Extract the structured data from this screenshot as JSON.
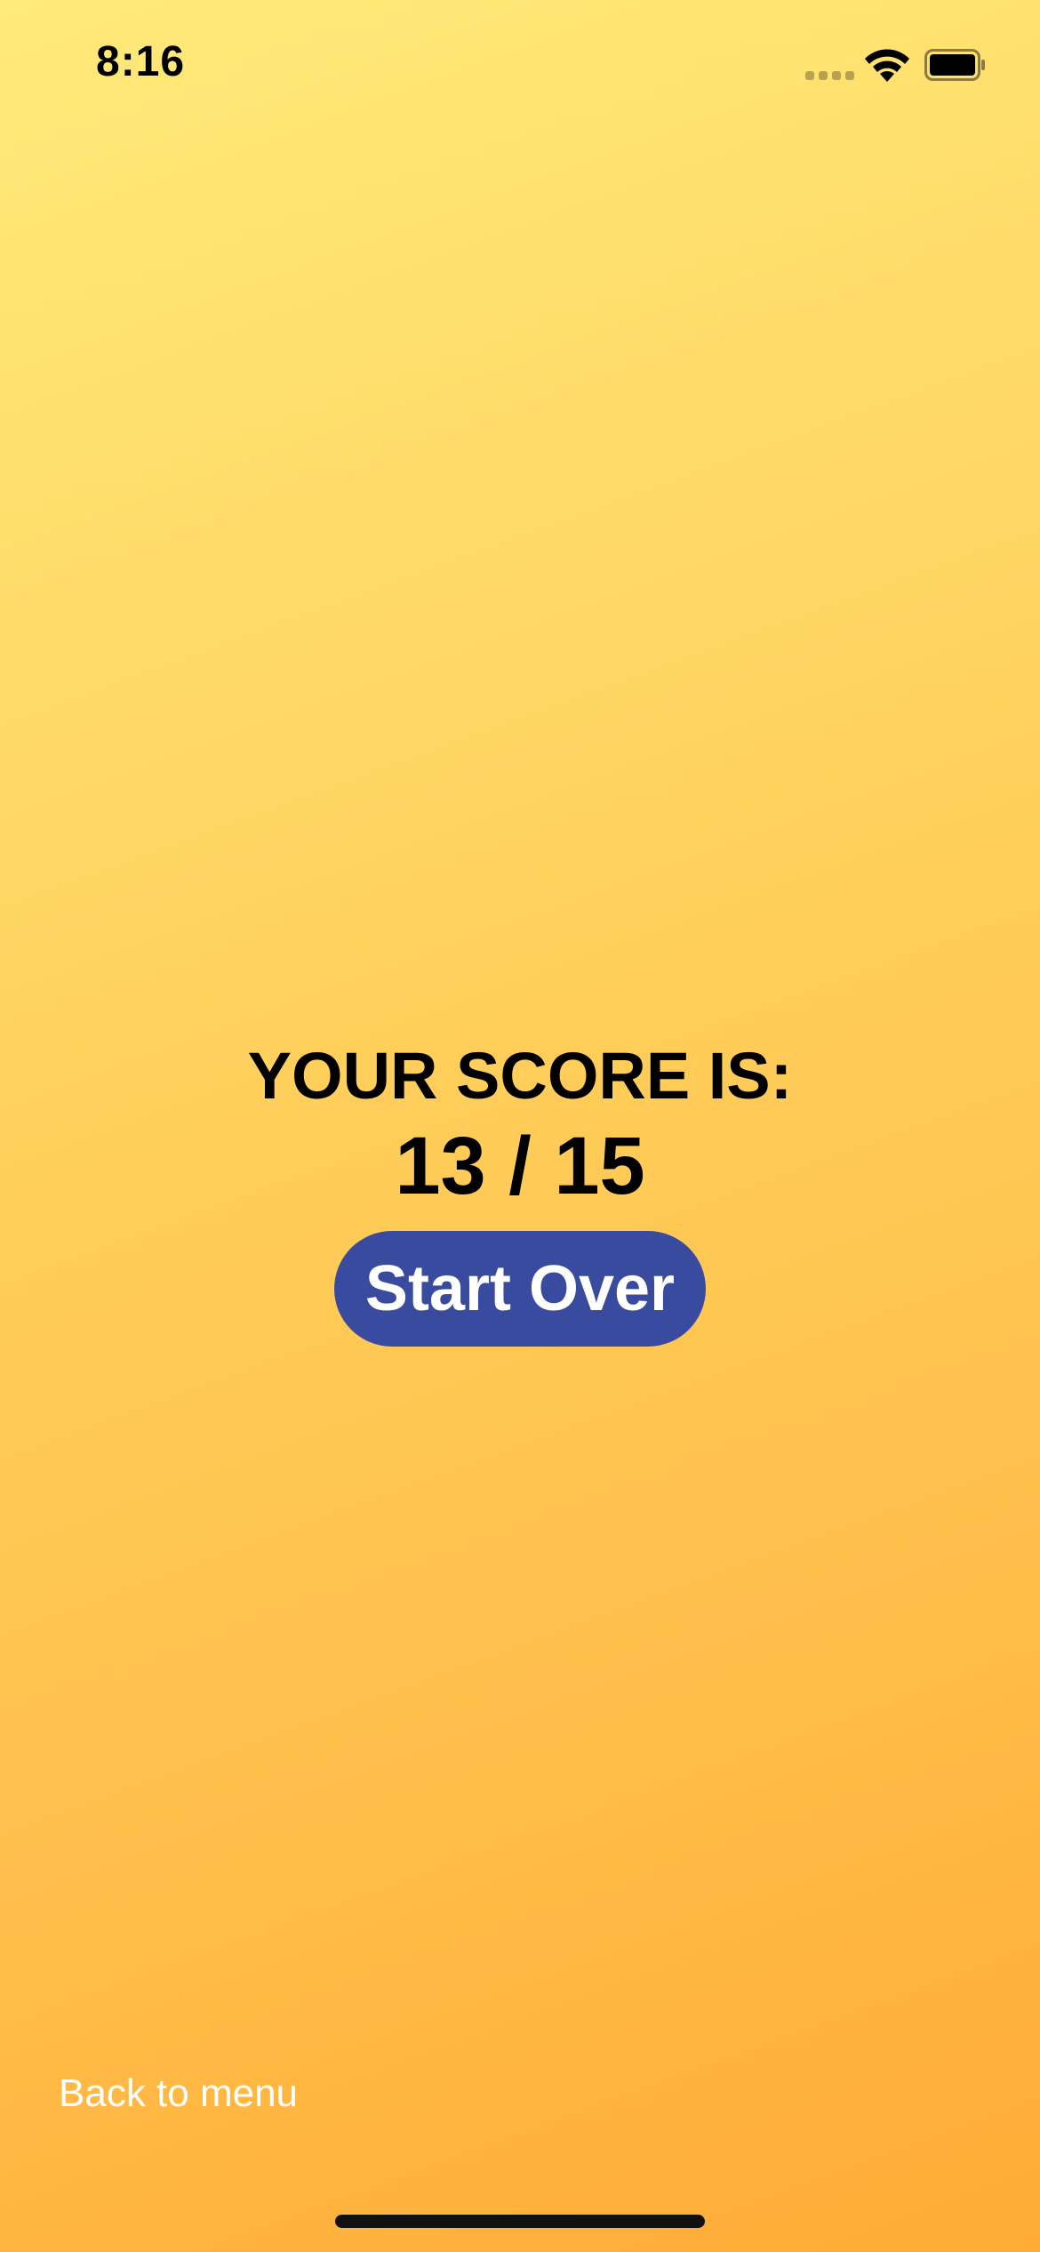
{
  "status_bar": {
    "time": "8:16",
    "icons": [
      "cellular-signal-icon",
      "wifi-icon",
      "battery-icon"
    ]
  },
  "score": {
    "label": "YOUR SCORE IS:",
    "value": "13 / 15"
  },
  "actions": {
    "start_over_label": "Start Over",
    "back_to_menu_label": "Back to menu"
  },
  "colors": {
    "background_top": "#ffea7a",
    "background_bottom": "#ffab35",
    "button": "#384b9e",
    "button_text": "#ffffff",
    "link_text": "#ffffff"
  }
}
